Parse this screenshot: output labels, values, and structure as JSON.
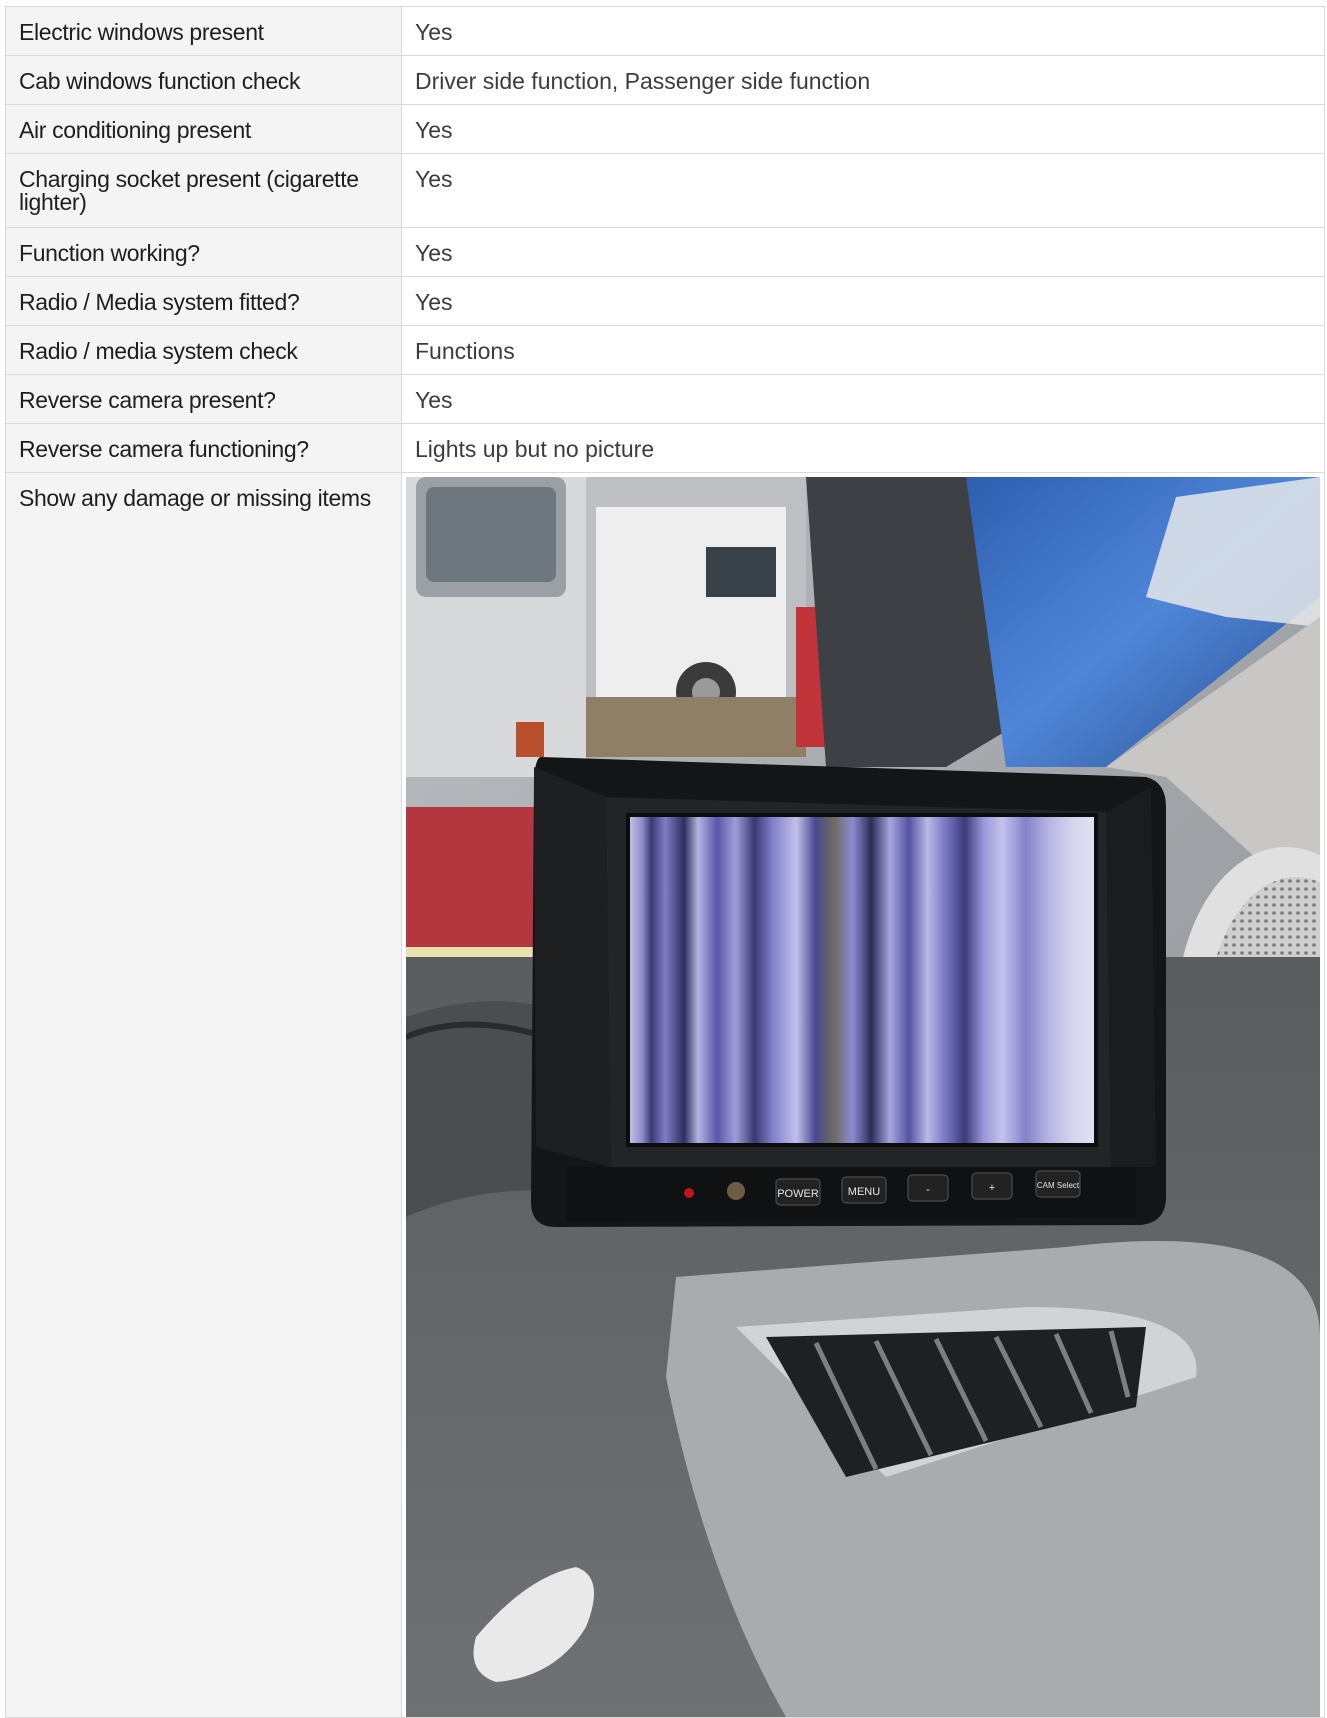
{
  "rows": [
    {
      "label": "Electric windows present",
      "value": "Yes"
    },
    {
      "label": "Cab windows function check",
      "value": "Driver side function, Passenger side function"
    },
    {
      "label": "Air conditioning present",
      "value": "Yes"
    },
    {
      "label": "Charging socket present (cigarette lighter)",
      "value": "Yes"
    },
    {
      "label": "Function working?",
      "value": "Yes"
    },
    {
      "label": "Radio / Media system fitted?",
      "value": "Yes"
    },
    {
      "label": "Radio / media system check",
      "value": "Functions"
    },
    {
      "label": "Reverse camera present?",
      "value": "Yes"
    },
    {
      "label": "Reverse camera functioning?",
      "value": "Lights up but no picture"
    }
  ],
  "photo_row": {
    "label": "Show any damage or missing items",
    "monitor_buttons": [
      "POWER",
      "MENU",
      "-",
      "+",
      "CAM Select"
    ]
  }
}
